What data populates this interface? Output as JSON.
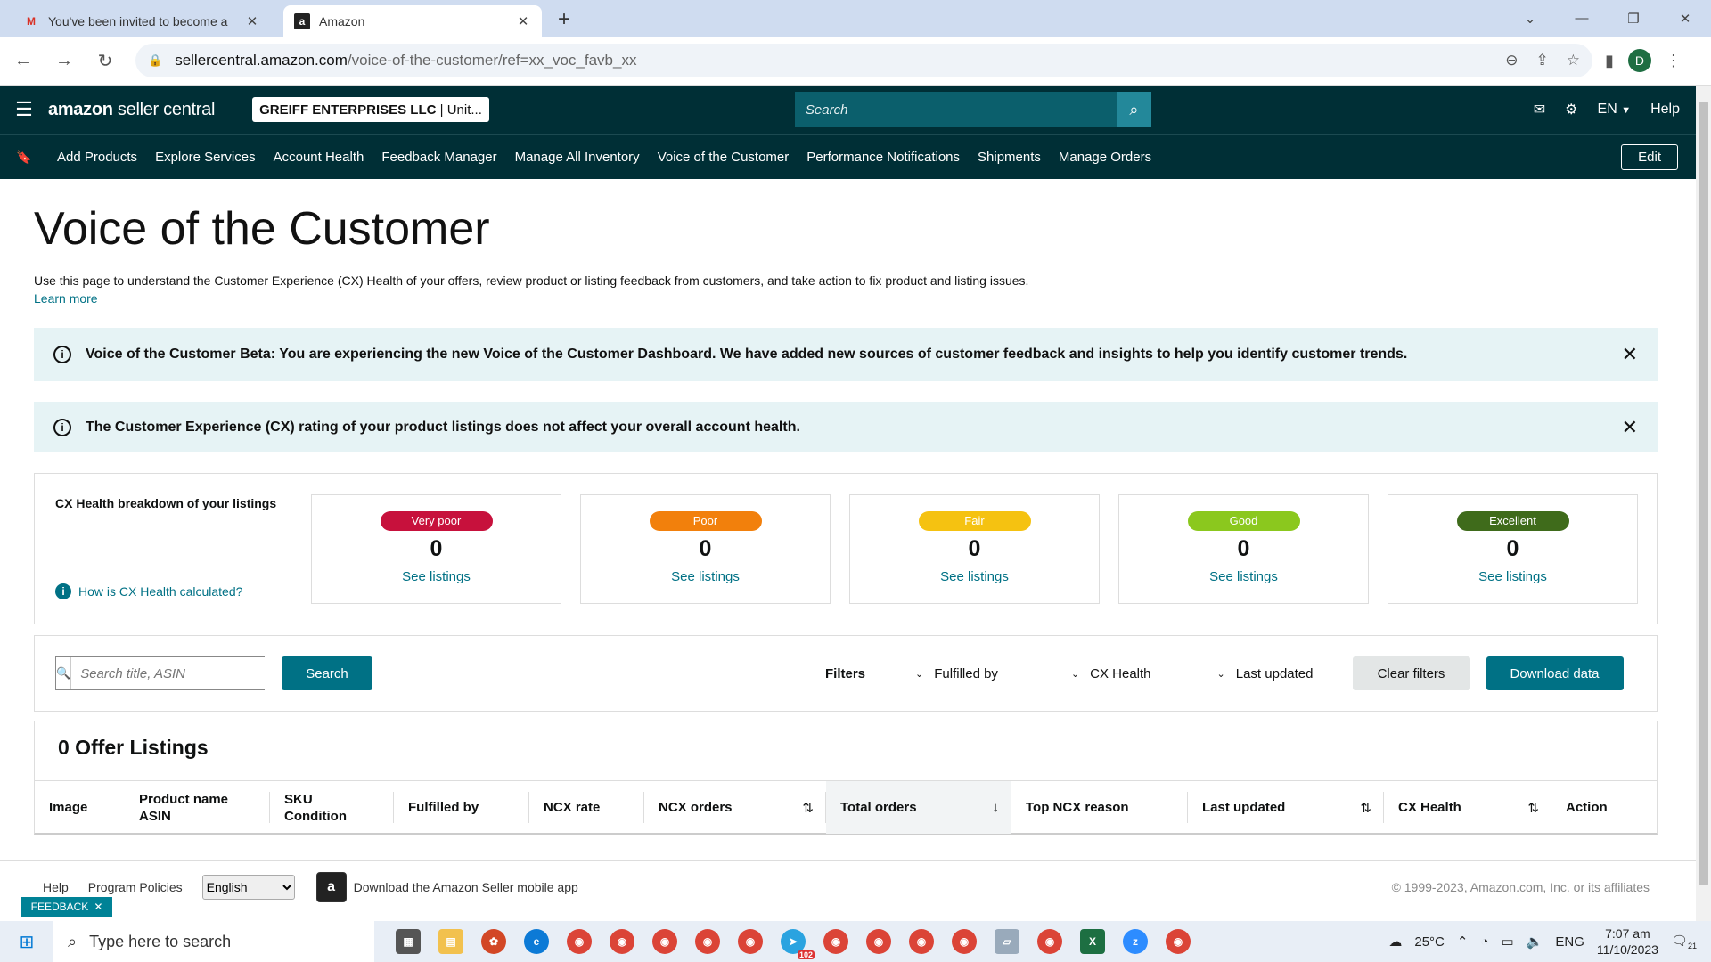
{
  "browser": {
    "tabs": [
      {
        "title": "You've been invited to become a",
        "favicon": "gmail-icon"
      },
      {
        "title": "Amazon",
        "favicon": "amazon-icon"
      }
    ],
    "new_tab": "+",
    "url_host": "sellercentral.amazon.com",
    "url_path": "/voice-of-the-customer/ref=xx_voc_favb_xx",
    "profile_initial": "D"
  },
  "header": {
    "logo_bold": "amazon",
    "logo_light": " seller central",
    "account_name": "GREIFF ENTERPRISES LLC",
    "account_region": "| Unit...",
    "search_placeholder": "Search",
    "language": "EN",
    "help": "Help"
  },
  "nav": {
    "links": [
      "Add Products",
      "Explore Services",
      "Account Health",
      "Feedback Manager",
      "Manage All Inventory",
      "Voice of the Customer",
      "Performance Notifications",
      "Shipments",
      "Manage Orders"
    ],
    "edit": "Edit"
  },
  "page": {
    "title": "Voice of the Customer",
    "intro": "Use this page to understand the Customer Experience (CX) Health of your offers, review product or listing feedback from customers, and take action to fix product and listing issues.",
    "learn_more": "Learn more"
  },
  "alerts": [
    "Voice of the Customer Beta: You are experiencing the new Voice of the Customer Dashboard. We have added new sources of customer feedback and insights to help you identify customer trends.",
    "The Customer Experience (CX) rating of your product listings does not affect your overall account health."
  ],
  "cx": {
    "label": "CX Health breakdown of your listings",
    "how_link": "How is CX Health calculated?",
    "buckets": [
      {
        "name": "Very poor",
        "count": "0",
        "link": "See listings",
        "color": "#c7113c"
      },
      {
        "name": "Poor",
        "count": "0",
        "link": "See listings",
        "color": "#f2800c"
      },
      {
        "name": "Fair",
        "count": "0",
        "link": "See listings",
        "color": "#f5c211"
      },
      {
        "name": "Good",
        "count": "0",
        "link": "See listings",
        "color": "#8bc81e"
      },
      {
        "name": "Excellent",
        "count": "0",
        "link": "See listings",
        "color": "#3f6b1b"
      }
    ]
  },
  "filters": {
    "search_placeholder": "Search title, ASIN",
    "search_button": "Search",
    "label": "Filters",
    "dropdowns": [
      "Fulfilled by",
      "CX Health",
      "Last updated"
    ],
    "clear": "Clear filters",
    "download": "Download data"
  },
  "listings": {
    "title": "0 Offer Listings",
    "columns": {
      "image": "Image",
      "product_name": "Product name",
      "asin": "ASIN",
      "sku": "SKU",
      "condition": "Condition",
      "fulfilled_by": "Fulfilled by",
      "ncx_rate": "NCX rate",
      "ncx_orders": "NCX orders",
      "total_orders": "Total orders",
      "top_ncx_reason": "Top NCX reason",
      "last_updated": "Last updated",
      "cx_health": "CX Health",
      "action": "Action"
    }
  },
  "footer": {
    "help": "Help",
    "program_policies": "Program Policies",
    "language": "English",
    "app_text": "Download the Amazon Seller mobile app",
    "copyright": "© 1999-2023, Amazon.com, Inc. or its affiliates",
    "feedback": "FEEDBACK"
  },
  "taskbar": {
    "search_placeholder": "Type here to search",
    "weather": "25°C",
    "lang": "ENG",
    "time": "7:07 am",
    "date": "11/10/2023",
    "notif_count": "21",
    "badge": "102"
  }
}
